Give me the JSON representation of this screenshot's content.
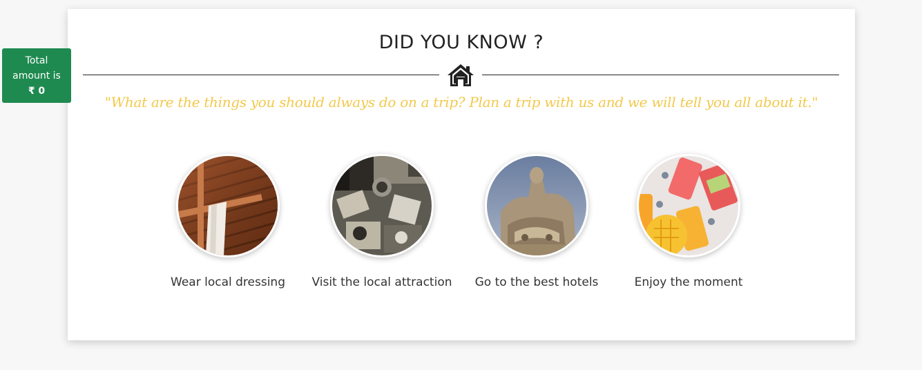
{
  "badge": {
    "line1": "Total",
    "line2": "amount is",
    "amount": "₹ 0",
    "color": "#1e8a50"
  },
  "section": {
    "title": "DID YOU KNOW ?",
    "icon": "home-icon",
    "quote": "\"What are the things you should always do on a trip? Plan a trip with us and we will tell you all about it.\"",
    "quote_color": "#f2c94c"
  },
  "features": [
    {
      "label": "Wear local dressing",
      "image": "wooden-cross-photo"
    },
    {
      "label": "Visit the local attraction",
      "image": "market-street-photo"
    },
    {
      "label": "Go to the best hotels",
      "image": "statue-photo"
    },
    {
      "label": "Enjoy the moment",
      "image": "fruit-popsicles-photo"
    }
  ]
}
